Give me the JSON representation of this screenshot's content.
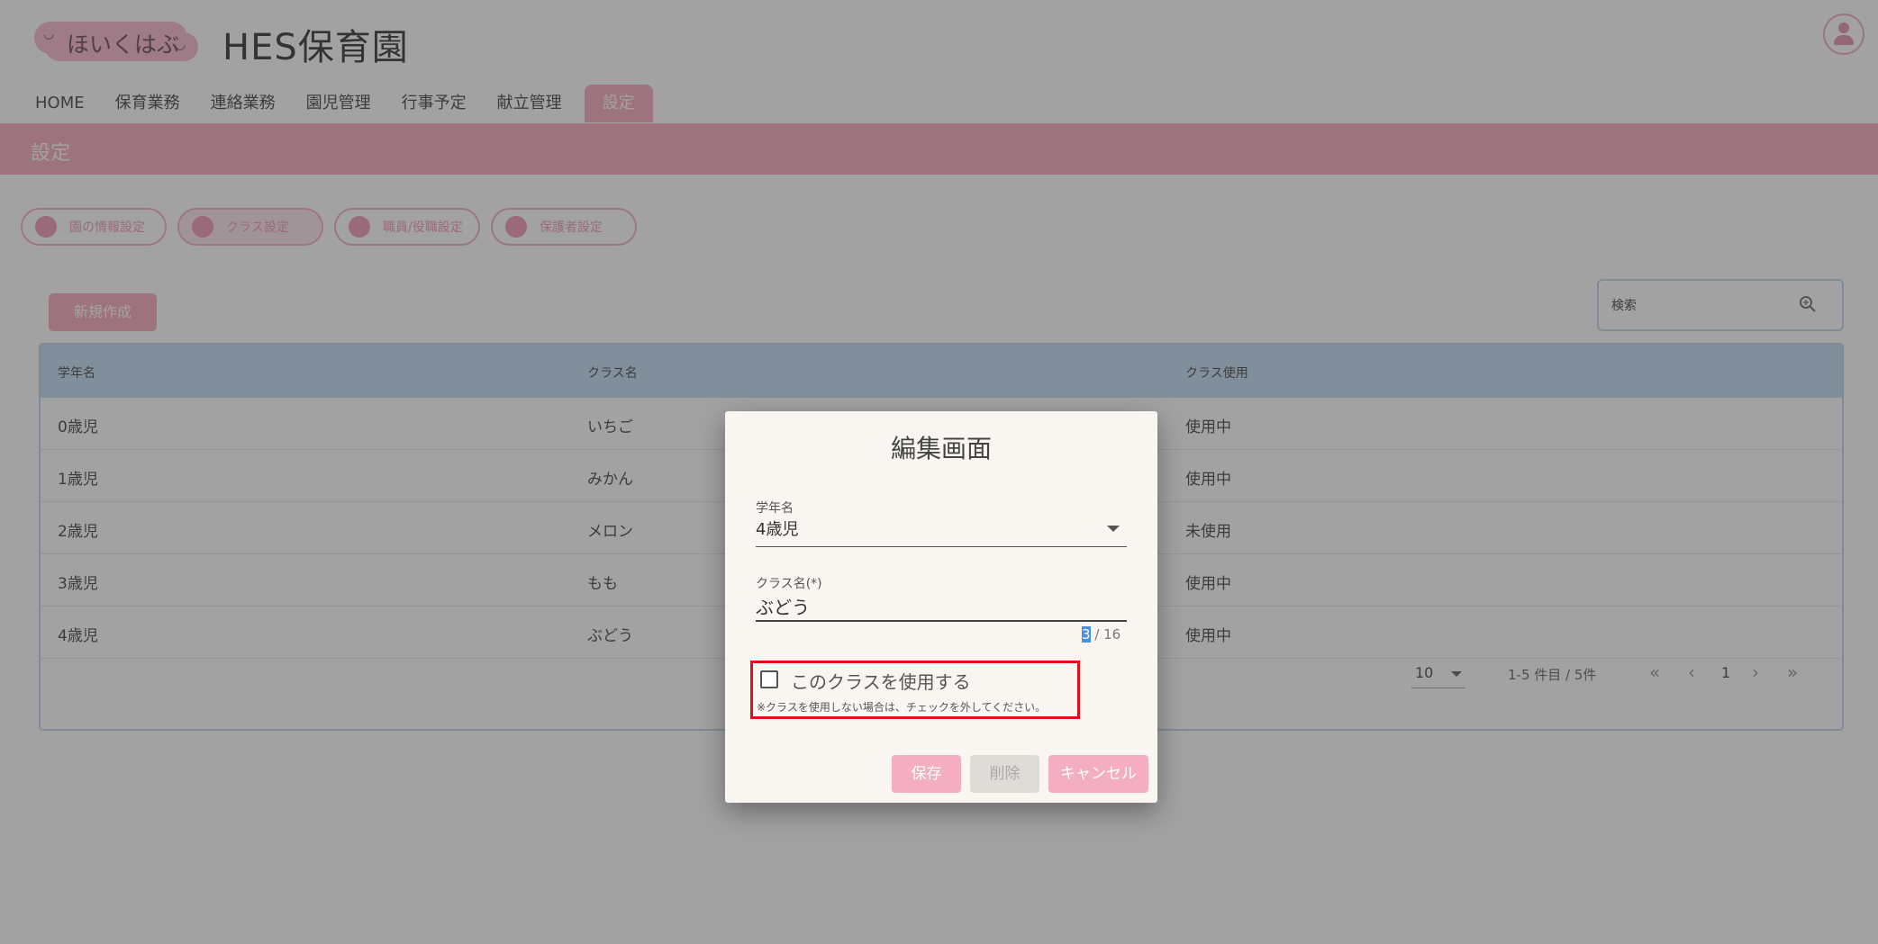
{
  "app": {
    "logo_text": "ほいくはぶ",
    "org_name": "HES保育園"
  },
  "nav": {
    "items": [
      "HOME",
      "保育業務",
      "連絡業務",
      "園児管理",
      "行事予定",
      "献立管理",
      "設定"
    ],
    "active": "設定"
  },
  "page": {
    "title": "設定"
  },
  "subtabs": [
    "園の情報設定",
    "クラス設定",
    "職員/役職設定",
    "保護者設定"
  ],
  "toolbar": {
    "new_label": "新規作成",
    "search_placeholder": "検索"
  },
  "table": {
    "headers": [
      "学年名",
      "クラス名",
      "クラス使用"
    ],
    "rows": [
      [
        "0歳児",
        "いちご",
        "使用中"
      ],
      [
        "1歳児",
        "みかん",
        "使用中"
      ],
      [
        "2歳児",
        "メロン",
        "未使用"
      ],
      [
        "3歳児",
        "もも",
        "使用中"
      ],
      [
        "4歳児",
        "ぶどう",
        "使用中"
      ]
    ]
  },
  "pagination": {
    "per_page": "10",
    "info": "1-5 件目 / 5件",
    "page": "1"
  },
  "dialog": {
    "title": "編集画面",
    "grade_label": "学年名",
    "grade_value": "4歳児",
    "class_label": "クラス名(*)",
    "class_value": "ぶどう",
    "counter_current": "3",
    "counter_rest": " / 16",
    "checkbox_label": "このクラスを使用する",
    "checkbox_note": "※クラスを使用しない場合は、チェックを外してください。",
    "checkbox_checked": false,
    "save_label": "保存",
    "delete_label": "削除",
    "cancel_label": "キャンセル"
  },
  "colors": {
    "accent_pink": "#f4a0b6",
    "table_header_blue": "#bcd7f0",
    "highlight_red": "#e0101b"
  }
}
